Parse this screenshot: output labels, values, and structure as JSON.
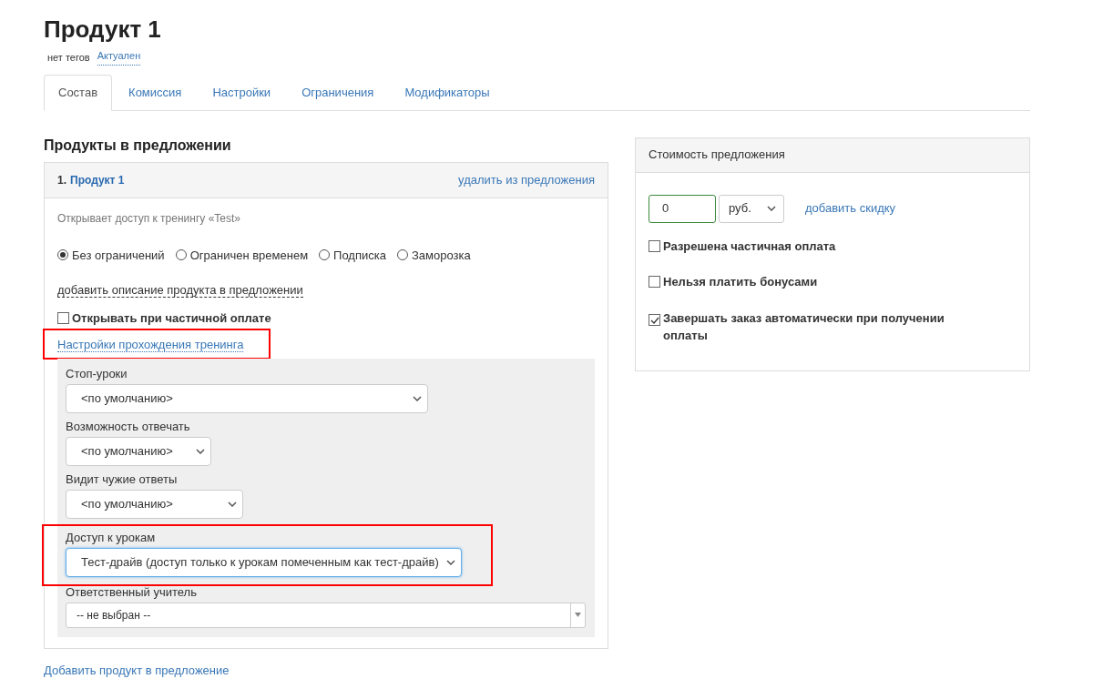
{
  "title": "Продукт 1",
  "meta": {
    "tags": "нет тегов",
    "status": "Актуален"
  },
  "tabs": [
    {
      "label": "Состав",
      "selected": true
    },
    {
      "label": "Комиссия",
      "selected": false
    },
    {
      "label": "Настройки",
      "selected": false
    },
    {
      "label": "Ограничения",
      "selected": false
    },
    {
      "label": "Модификаторы",
      "selected": false
    }
  ],
  "products_section": {
    "heading": "Продукты в предложении",
    "product": {
      "number": "1.",
      "name": "Продукт 1",
      "remove": "удалить из предложения",
      "access_text": "Открывает доступ к тренингу «Test»",
      "modes": [
        {
          "label": "Без ограничений",
          "selected": true
        },
        {
          "label": "Ограничен временем",
          "selected": false
        },
        {
          "label": "Подписка",
          "selected": false
        },
        {
          "label": "Заморозка",
          "selected": false
        }
      ],
      "add_description": "добавить описание продукта в предложении",
      "partial_open": {
        "label": "Открывать при частичной оплате",
        "checked": false
      },
      "training_settings": {
        "link": "Настройки прохождения тренинга",
        "highlighted": true,
        "fields": [
          {
            "label": "Стоп-уроки",
            "value": "<по умолчанию>",
            "kind": "select",
            "highlighted": false,
            "focused": false
          },
          {
            "label": "Возможность отвечать",
            "value": "<по умолчанию>",
            "kind": "select",
            "highlighted": false,
            "focused": false
          },
          {
            "label": "Видит чужие ответы",
            "value": "<по умолчанию>",
            "kind": "select",
            "highlighted": false,
            "focused": false
          },
          {
            "label": "Доступ к урокам",
            "value": "Тест-драйв (доступ только к урокам помеченным как тест-драйв)",
            "kind": "select",
            "highlighted": true,
            "focused": true
          },
          {
            "label": "Ответственный учитель",
            "value": "-- не выбран --",
            "kind": "combo",
            "highlighted": false,
            "focused": false
          }
        ]
      }
    },
    "add_product": "Добавить продукт в предложение"
  },
  "price_panel": {
    "heading": "Стоимость предложения",
    "amount": "0",
    "currency": "руб.",
    "discount": "добавить скидку",
    "options": [
      {
        "label": "Разрешена частичная оплата",
        "checked": false
      },
      {
        "label": "Нельзя платить бонусами",
        "checked": false
      },
      {
        "label": "Завершать заказ автоматически при получении оплаты",
        "checked": true
      }
    ]
  }
}
